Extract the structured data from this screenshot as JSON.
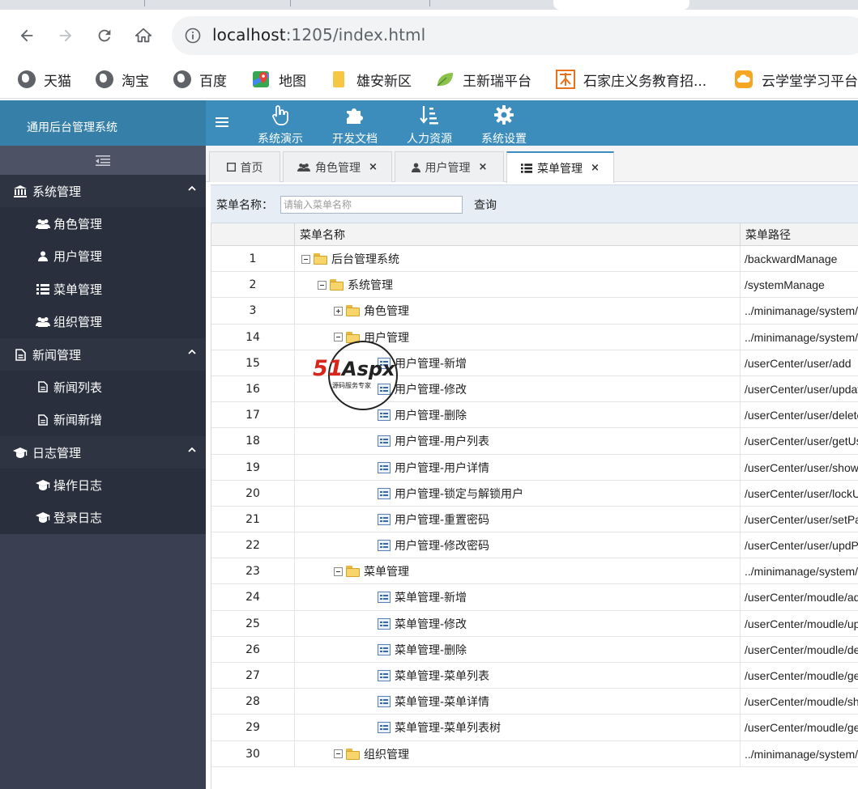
{
  "browser": {
    "url_host": "localhost",
    "url_rest": ":1205/index.html",
    "bookmarks": [
      {
        "label": "天猫",
        "icon": "globe-icon"
      },
      {
        "label": "淘宝",
        "icon": "globe-icon"
      },
      {
        "label": "百度",
        "icon": "globe-icon"
      },
      {
        "label": "地图",
        "icon": "map-pin-icon"
      },
      {
        "label": "雄安新区",
        "icon": "folder-icon"
      },
      {
        "label": "王新瑞平台",
        "icon": "leaf-icon"
      },
      {
        "label": "石家庄义务教育招...",
        "icon": "school-icon"
      },
      {
        "label": "云学堂学习平台",
        "icon": "cloud-icon"
      }
    ]
  },
  "app": {
    "title": "通用后台管理系统",
    "topnav": [
      {
        "label": "系统演示",
        "icon": "hand-pointer-icon"
      },
      {
        "label": "开发文档",
        "icon": "puzzle-icon"
      },
      {
        "label": "人力资源",
        "icon": "sort-list-icon"
      },
      {
        "label": "系统设置",
        "icon": "gear-icon"
      }
    ],
    "colors": {
      "header": "#3c8dbc",
      "logo_bg": "#367fa9",
      "sidebar": "#3a3f51"
    }
  },
  "sidebar": {
    "groups": [
      {
        "label": "系统管理",
        "icon": "bank-icon",
        "items": [
          {
            "label": "角色管理",
            "icon": "users-icon"
          },
          {
            "label": "用户管理",
            "icon": "user-icon"
          },
          {
            "label": "菜单管理",
            "icon": "list-icon"
          },
          {
            "label": "组织管理",
            "icon": "users-icon"
          }
        ]
      },
      {
        "label": "新闻管理",
        "icon": "file-icon",
        "items": [
          {
            "label": "新闻列表",
            "icon": "file-icon"
          },
          {
            "label": "新闻新增",
            "icon": "file-icon"
          }
        ]
      },
      {
        "label": "日志管理",
        "icon": "graduation-cap-icon",
        "items": [
          {
            "label": "操作日志",
            "icon": "graduation-cap-icon"
          },
          {
            "label": "登录日志",
            "icon": "graduation-cap-icon"
          }
        ]
      }
    ]
  },
  "tabs": [
    {
      "label": "首页",
      "icon": "square-icon",
      "closable": false
    },
    {
      "label": "角色管理",
      "icon": "users-icon",
      "closable": true,
      "close": "×"
    },
    {
      "label": "用户管理",
      "icon": "user-icon",
      "closable": true,
      "close": "×"
    },
    {
      "label": "菜单管理",
      "icon": "list-icon",
      "closable": true,
      "close": "×",
      "active": true
    }
  ],
  "search": {
    "label": "菜单名称：",
    "placeholder": "请输入菜单名称",
    "button": "查询"
  },
  "grid": {
    "headers": [
      "",
      "菜单名称",
      "菜单路径"
    ],
    "rows": [
      {
        "num": "1",
        "name": "后台管理系统",
        "path": "/backwardManage",
        "level": 0,
        "type": "folder",
        "exp": "minus"
      },
      {
        "num": "2",
        "name": "系统管理",
        "path": "/systemManage",
        "level": 1,
        "type": "folder",
        "exp": "minus"
      },
      {
        "num": "3",
        "name": "角色管理",
        "path": "../minimanage/system/r",
        "level": 2,
        "type": "folder",
        "exp": "plus"
      },
      {
        "num": "14",
        "name": "用户管理",
        "path": "../minimanage/system/u",
        "level": 2,
        "type": "folder",
        "exp": "minus"
      },
      {
        "num": "15",
        "name": "用户管理-新增",
        "path": "/userCenter/user/add",
        "level": 3,
        "type": "leaf"
      },
      {
        "num": "16",
        "name": "用户管理-修改",
        "path": "/userCenter/user/updat",
        "level": 3,
        "type": "leaf"
      },
      {
        "num": "17",
        "name": "用户管理-删除",
        "path": "/userCenter/user/delete",
        "level": 3,
        "type": "leaf"
      },
      {
        "num": "18",
        "name": "用户管理-用户列表",
        "path": "/userCenter/user/getUs",
        "level": 3,
        "type": "leaf"
      },
      {
        "num": "19",
        "name": "用户管理-用户详情",
        "path": "/userCenter/user/showD",
        "level": 3,
        "type": "leaf"
      },
      {
        "num": "20",
        "name": "用户管理-锁定与解锁用户",
        "path": "/userCenter/user/lockUs",
        "level": 3,
        "type": "leaf"
      },
      {
        "num": "21",
        "name": "用户管理-重置密码",
        "path": "/userCenter/user/setPas",
        "level": 3,
        "type": "leaf"
      },
      {
        "num": "22",
        "name": "用户管理-修改密码",
        "path": "/userCenter/user/updPw",
        "level": 3,
        "type": "leaf"
      },
      {
        "num": "23",
        "name": "菜单管理",
        "path": "../minimanage/system/r",
        "level": 2,
        "type": "folder",
        "exp": "minus"
      },
      {
        "num": "24",
        "name": "菜单管理-新增",
        "path": "/userCenter/moudle/ad",
        "level": 3,
        "type": "leaf"
      },
      {
        "num": "25",
        "name": "菜单管理-修改",
        "path": "/userCenter/moudle/up",
        "level": 3,
        "type": "leaf"
      },
      {
        "num": "26",
        "name": "菜单管理-删除",
        "path": "/userCenter/moudle/del",
        "level": 3,
        "type": "leaf"
      },
      {
        "num": "27",
        "name": "菜单管理-菜单列表",
        "path": "/userCenter/moudle/ge",
        "level": 3,
        "type": "leaf"
      },
      {
        "num": "28",
        "name": "菜单管理-菜单详情",
        "path": "/userCenter/moudle/sho",
        "level": 3,
        "type": "leaf"
      },
      {
        "num": "29",
        "name": "菜单管理-菜单列表树",
        "path": "/userCenter/moudle/ge",
        "level": 3,
        "type": "leaf"
      },
      {
        "num": "30",
        "name": "组织管理",
        "path": "../minimanage/system/o",
        "level": 2,
        "type": "folder",
        "exp": "minus"
      }
    ]
  },
  "watermark": {
    "text": "51Aspx",
    "subtext": "源码服务专家"
  }
}
